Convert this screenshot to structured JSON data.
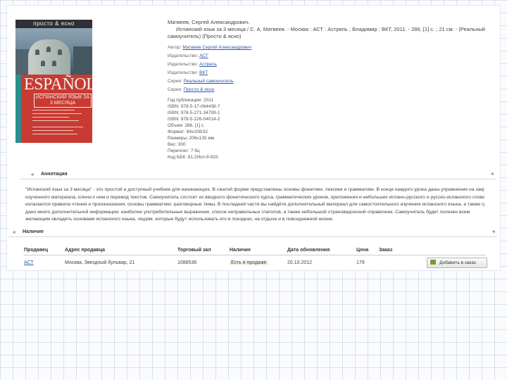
{
  "book": {
    "heading_author": "Матвеев, Сергей Александрович.",
    "bibliographic_line_1": "Испанский язык за 3 месяца / С. А. Матвеев. - Москва : АСТ : Астрель ; Владимир : ВКТ, 2011. - 286, [1] с. ; 21 см. - (Реальный",
    "bibliographic_line_2": "самоучитель) (Просто & ясно)",
    "fields": [
      {
        "label": "Автор:",
        "value": "Матвеев Сергей Александрович",
        "link": true
      },
      {
        "label": "Издательство:",
        "value": "АСТ",
        "link": true
      },
      {
        "label": "Издательство:",
        "value": "Астрель",
        "link": true
      },
      {
        "label": "Издательство:",
        "value": "ВКТ",
        "link": true
      },
      {
        "label": "Серия:",
        "value": "Реальный самоучитель",
        "link": true
      },
      {
        "label": "Серия:",
        "value": "Просто & ясно",
        "link": true
      }
    ],
    "specs": [
      "Год публикации: 2011",
      "ISBN: 978-5-17-064438-7",
      "ISBN: 978-5-271-34799-1",
      "ISBN: 978-5-226-04014-2",
      "Объем: 286, [1] с.",
      "Формат: 84х108/32",
      "Размеры: 206х135 мм",
      "Вес: 300",
      "Переплет: 7 бц",
      "Код ББК: 81.2Исп-9-923"
    ]
  },
  "cover": {
    "series_text": "просто & ясно",
    "title": "ESPAÑOL",
    "subtitle": "ИСПАНСКИЙ ЯЗЫК ЗА 3 МЕСЯЦА"
  },
  "annotation": {
    "title": "Аннотация",
    "lines": [
      "\"Испанский язык за 3 месяца\" - это простой и доступный учебник для начинающих. В сжатой форме представлены основы фонетики, лексики и грамматики. В конце каждого урока даны упражнения на закрепление",
      "изученного материала, ключи к ним и перевод текстов. Самоучитель состоит из вводного фонетического курса, грамматических уроков, приложения и небольших испано-русского и русско-испанского словарей. В первых частях",
      "излагаются правила чтения и произношения, основы грамматики, разговорные темы. В последней части вы найдёте дополнительный материал для самостоятельного изучения испанского языка, а также грамматические таблицы. В приложении",
      "дано много дополнительной информации: наиболее употребительные выражения, список неправильных глаголов, а также небольшой страноведческий справочник. Самоучитель будет полезен всем",
      "желающим овладеть основами испанского языка, людям, которые будут использовать его в поездках, на отдыхе и в повседневной жизни."
    ]
  },
  "availability": {
    "title": "Наличие",
    "columns": [
      "Продавец",
      "Адрес продавца",
      "Торговый зал",
      "Наличие",
      "Дата обновления",
      "Цена",
      "Заказ"
    ],
    "rows": [
      {
        "seller": "АСТ",
        "address": "Москва, Звездный бульвар, 21",
        "hall": "1088536",
        "availability": "Есть в продаже",
        "updated": "20.10.2012",
        "price": "179",
        "order_button": "Добавить в заказ"
      }
    ]
  }
}
